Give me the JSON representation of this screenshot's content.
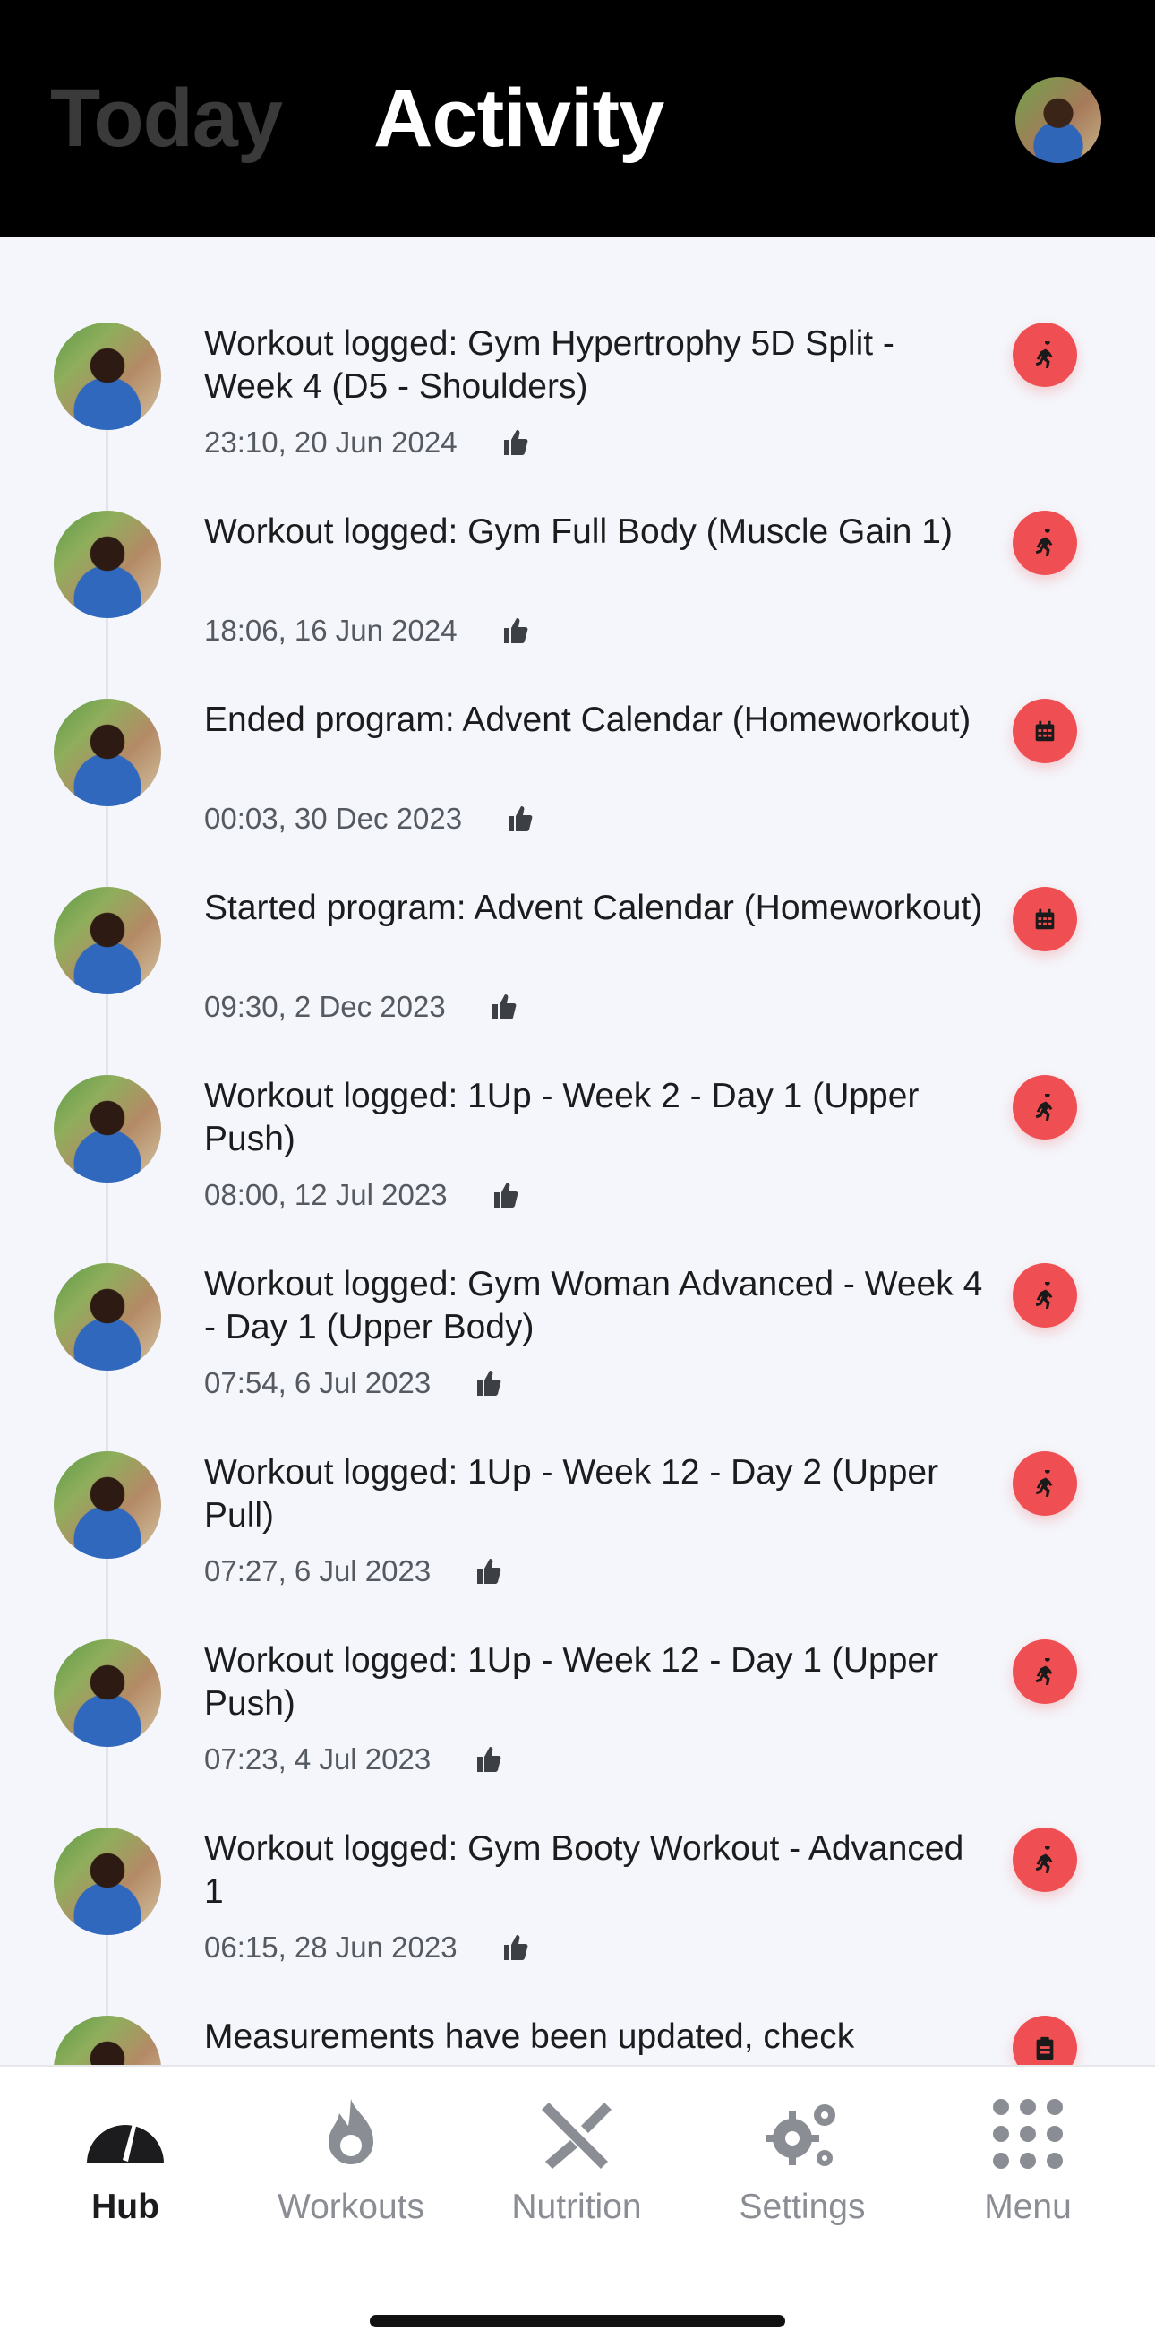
{
  "header": {
    "tab_today": "Today",
    "tab_activity": "Activity"
  },
  "activity_items": [
    {
      "title": "Workout logged: Gym Hypertrophy 5D Split - Week 4 (D5 - Shoulders)",
      "time": "23:10, 20 Jun 2024",
      "badge_icon": "running-icon"
    },
    {
      "title": "Workout logged: Gym Full Body (Muscle Gain 1)",
      "time": "18:06, 16 Jun 2024",
      "badge_icon": "running-icon"
    },
    {
      "title": "Ended program: Advent Calendar (Homeworkout)",
      "time": "00:03, 30 Dec 2023",
      "badge_icon": "calendar-icon"
    },
    {
      "title": "Started program: Advent Calendar (Homeworkout)",
      "time": "09:30, 2 Dec 2023",
      "badge_icon": "calendar-icon"
    },
    {
      "title": "Workout logged: 1Up - Week 2 - Day 1 (Upper Push)",
      "time": "08:00, 12 Jul 2023",
      "badge_icon": "running-icon"
    },
    {
      "title": "Workout logged: Gym Woman Advanced - Week 4 - Day 1 (Upper Body)",
      "time": "07:54, 6 Jul 2023",
      "badge_icon": "running-icon"
    },
    {
      "title": "Workout logged: 1Up - Week 12 - Day 2 (Upper Pull)",
      "time": "07:27, 6 Jul 2023",
      "badge_icon": "running-icon"
    },
    {
      "title": "Workout logged: 1Up - Week 12 - Day 1 (Upper Push)",
      "time": "07:23, 4 Jul 2023",
      "badge_icon": "running-icon"
    },
    {
      "title": "Workout logged: Gym Booty Workout - Advanced 1",
      "time": "06:15, 28 Jun 2023",
      "badge_icon": "running-icon"
    },
    {
      "title": "Measurements have been updated, check",
      "time": "",
      "badge_icon": "clipboard-icon"
    }
  ],
  "tabbar": {
    "hub": "Hub",
    "workouts": "Workouts",
    "nutrition": "Nutrition",
    "settings": "Settings",
    "menu": "Menu"
  },
  "colors": {
    "badge": "#ef4f52",
    "header_bg": "#000000",
    "feed_bg": "#f4f6fb"
  }
}
